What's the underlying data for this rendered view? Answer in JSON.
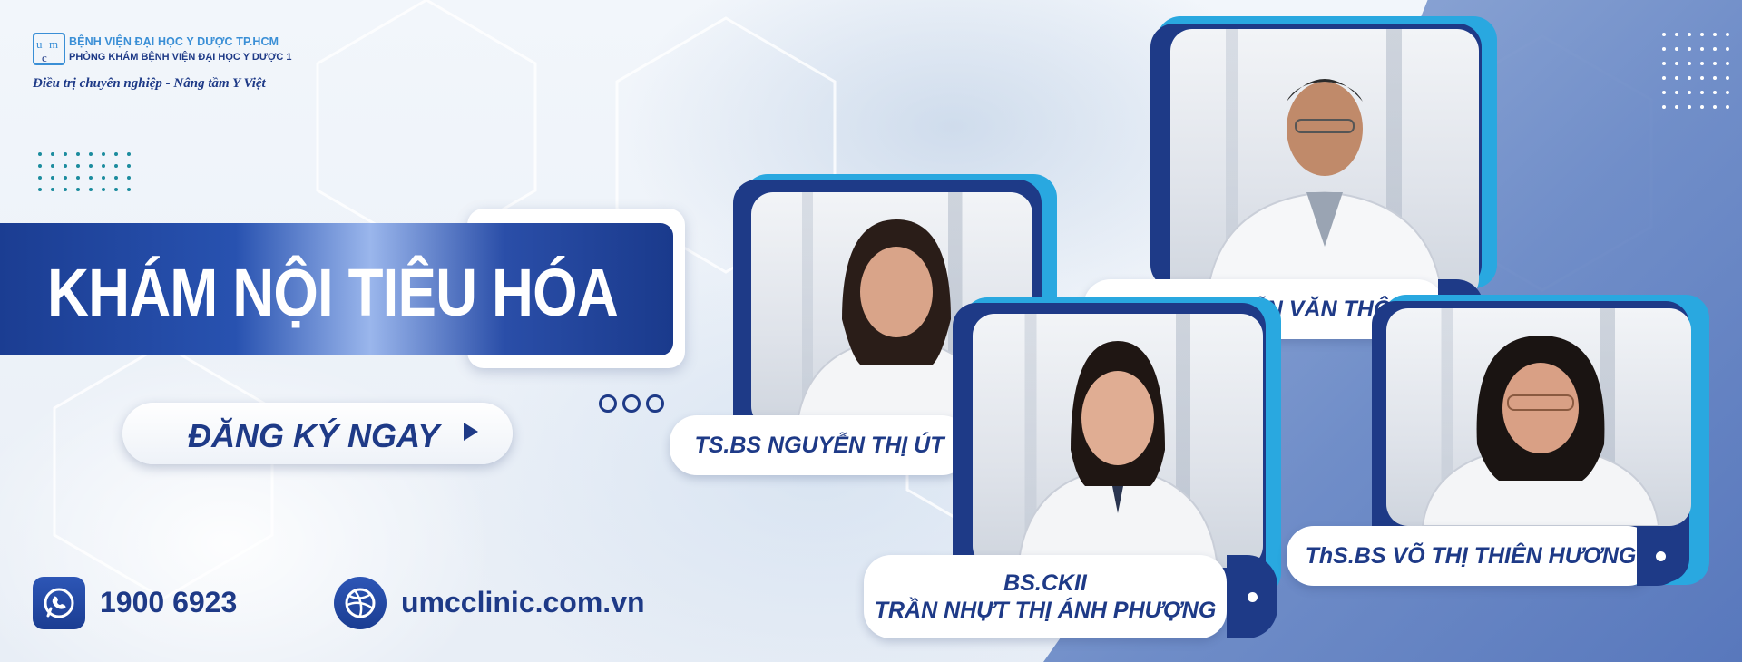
{
  "brand": {
    "hospital_name": "BỆNH VIỆN ĐẠI HỌC Y DƯỢC TP.HCM",
    "clinic_name": "PHÒNG KHÁM BỆNH VIỆN ĐẠI HỌC Y DƯỢC 1",
    "tagline": "Điều trị chuyên nghiệp - Nâng tầm Y Việt",
    "logo_icon": "umc-logo-icon"
  },
  "banner": {
    "title": "KHÁM NỘI TIÊU HÓA",
    "cta_label": "ĐĂNG KÝ NGAY",
    "cta_icon": "play-arrow-icon"
  },
  "contact": {
    "phone": "1900 6923",
    "phone_icon": "whatsapp-phone-icon",
    "website": "umcclinic.com.vn",
    "website_icon": "globe-ball-icon"
  },
  "doctors": [
    {
      "name": "TS.BS NGUYỄN THỊ ÚT"
    },
    {
      "name": "BS.CKI NGUYỄN VĂN THÔNG"
    },
    {
      "name_line1": "BS.CKII",
      "name_line2": "TRẦN NHỰT THỊ ÁNH PHƯỢNG"
    },
    {
      "name": "ThS.BS VÕ THỊ THIÊN HƯƠNG"
    }
  ],
  "colors": {
    "primary_navy": "#1e3a87",
    "accent_blue": "#3a8fd6",
    "light_blue": "#29a8e0",
    "background": "#eef3f9"
  }
}
